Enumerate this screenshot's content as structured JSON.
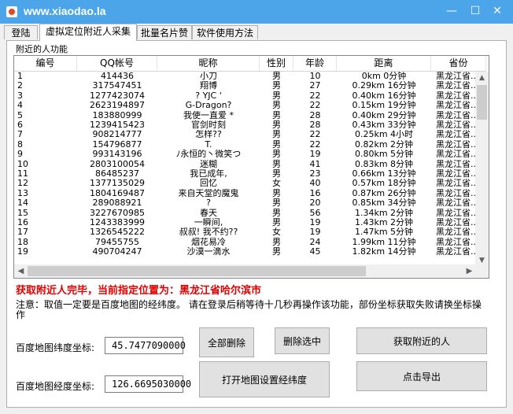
{
  "window": {
    "title": "www.xiaodao.la",
    "minimize": "—",
    "maximize": "☐",
    "close": "✕"
  },
  "tabs": [
    "登陆",
    "虚拟定位附近人采集",
    "批量名片赞",
    "软件使用方法"
  ],
  "panel_label": "附近的人功能",
  "grid": {
    "columns": [
      "编号",
      "QQ帐号",
      "昵称",
      "性别",
      "年龄",
      "距离",
      "省份"
    ],
    "rows": [
      [
        "1",
        "414436",
        "小刀",
        "男",
        "10",
        "0km 0分钟",
        "黑龙江省..."
      ],
      [
        "2",
        "317547451",
        "翔博",
        "男",
        "27",
        "0.29km 16分钟",
        "黑龙江省..."
      ],
      [
        "3",
        "1277423074",
        "?  YJC '",
        "男",
        "22",
        "0.40km 16分钟",
        "黑龙江省..."
      ],
      [
        "4",
        "2623194897",
        "G-Dragon?",
        "男",
        "22",
        "0.15km 19分钟",
        "黑龙江省..."
      ],
      [
        "5",
        "183880999",
        "我使一直爱 *",
        "男",
        "28",
        "0.40km 29分钟",
        "黑龙江省..."
      ],
      [
        "6",
        "1239415423",
        "官剑时刻",
        "男",
        "28",
        "0.43km 33分钟",
        "黑龙江省..."
      ],
      [
        "7",
        "908214777",
        "怎样??",
        "男",
        "22",
        "0.25km 4小时",
        "黑龙江省..."
      ],
      [
        "8",
        "154796877",
        "T.",
        "男",
        "22",
        "0.82km 2分钟",
        "黑龙江省..."
      ],
      [
        "9",
        "993143196",
        "ﾉ永恒的丶微笑つ",
        "男",
        "19",
        "0.80km 5分钟",
        "黑龙江省..."
      ],
      [
        "10",
        "2803100054",
        "迷糊",
        "男",
        "41",
        "0.83km 8分钟",
        "黑龙江省..."
      ],
      [
        "11",
        "86485237",
        "我已成年,",
        "男",
        "23",
        "0.66km 13分钟",
        "黑龙江省..."
      ],
      [
        "12",
        "1377135029",
        "回忆",
        "女",
        "40",
        "0.57km 18分钟",
        "黑龙江省..."
      ],
      [
        "13",
        "1804169487",
        "来自天堂的魔鬼",
        "男",
        "16",
        "0.87km 26分钟",
        "黑龙江省..."
      ],
      [
        "14",
        "289088921",
        "?",
        "男",
        "20",
        "0.85km 34分钟",
        "黑龙江省..."
      ],
      [
        "15",
        "3227670985",
        "春天",
        "男",
        "56",
        "1.34km 2分钟",
        "黑龙江省..."
      ],
      [
        "16",
        "1243383999",
        "一瞬间,",
        "男",
        "19",
        "1.43km 2分钟",
        "黑龙江省..."
      ],
      [
        "17",
        "1326545222",
        "叔叔! 我不约??",
        "女",
        "19",
        "1.47km 5分钟",
        "黑龙江省..."
      ],
      [
        "18",
        "79455755",
        "烟花易冷",
        "男",
        "24",
        "1.99km 11分钟",
        "黑龙江省..."
      ],
      [
        "19",
        "490704247",
        "沙漠一滴水",
        "男",
        "45",
        "1.82km 14分钟",
        "黑龙江省..."
      ]
    ]
  },
  "status_text": "获取附近人完毕，当前指定位置为：黑龙江省哈尔滨市",
  "note_text": "注意：取值一定要是百度地图的经纬度。 请在登录后稍等待十几秒再操作该功能，部份坐标获取失败请换坐标操作",
  "lat": {
    "label": "百度地图纬度坐标:",
    "value": "45.7477090000"
  },
  "lng": {
    "label": "百度地图经度坐标:",
    "value": "126.6695030000"
  },
  "buttons": {
    "delete_all": "全部删除",
    "delete_selected": "删除选中",
    "get_nearby": "获取附近的人",
    "open_map": "打开地图设置经纬度",
    "export": "点击导出"
  },
  "colors": {
    "titlebar": "#4ca5e8",
    "status": "#e00000"
  }
}
